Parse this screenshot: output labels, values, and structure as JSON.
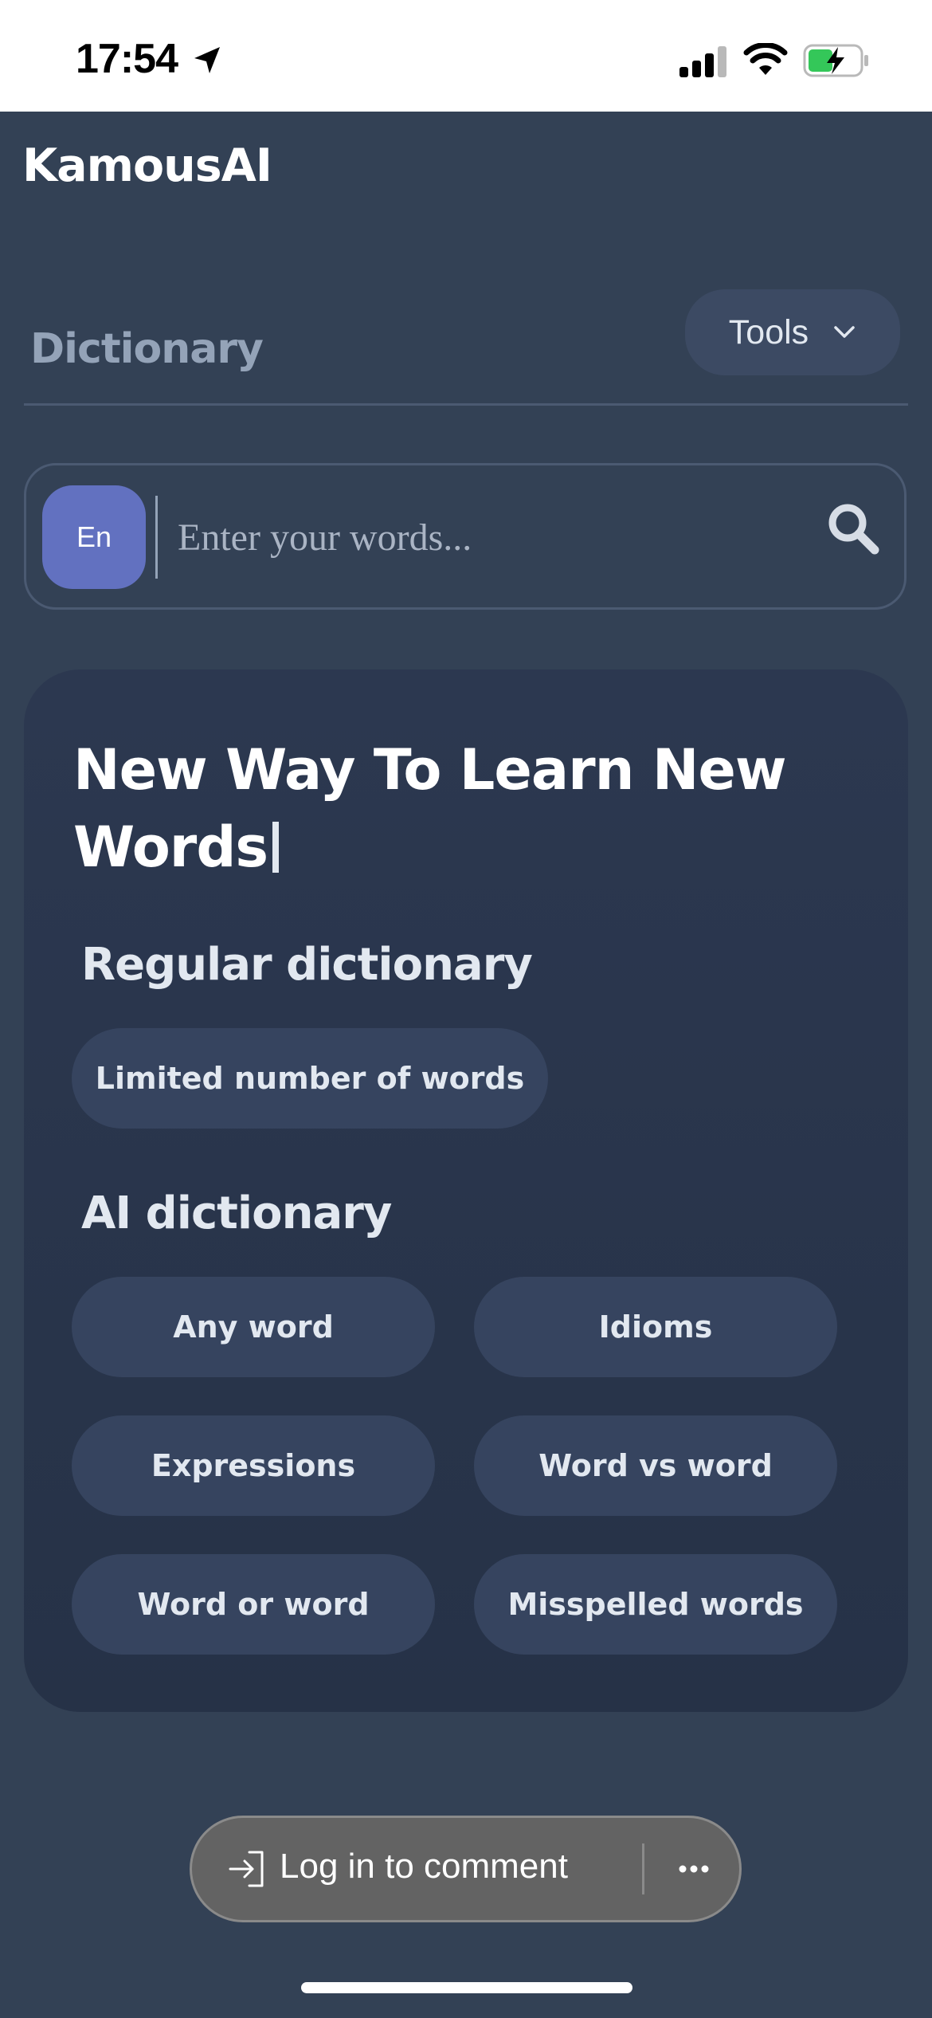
{
  "status_bar": {
    "time": "17:54",
    "icons": [
      "location-arrow-icon",
      "cellular-signal-icon",
      "wifi-icon",
      "battery-charging-icon"
    ]
  },
  "app": {
    "title": "KamousAI"
  },
  "nav": {
    "section": "Dictionary",
    "tools_label": "Tools"
  },
  "search": {
    "language": "En",
    "placeholder": "Enter your words..."
  },
  "card": {
    "heading": "New Way To Learn New Words",
    "regular": {
      "title": "Regular dictionary",
      "chips": [
        "Limited number of words"
      ]
    },
    "ai": {
      "title": "AI dictionary",
      "chips": [
        "Any word",
        "Idioms",
        "Expressions",
        "Word vs word",
        "Word or word",
        "Misspelled words"
      ]
    }
  },
  "comment_bar": {
    "login_label": "Log in to comment"
  },
  "colors": {
    "background": "#334155",
    "accent": "#6271c0",
    "chip": "#36445f"
  }
}
